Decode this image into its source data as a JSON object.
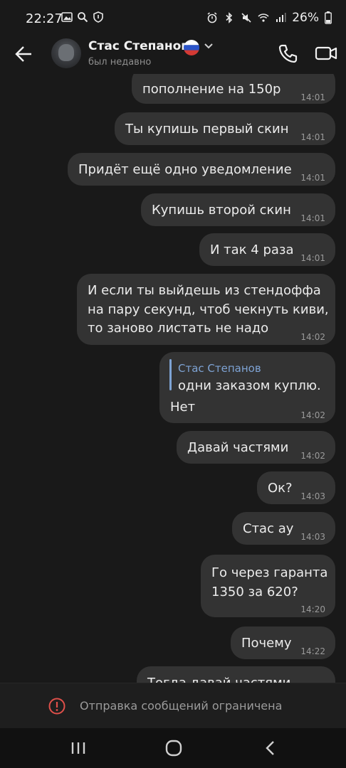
{
  "status_bar": {
    "time": "22:27",
    "battery": "26%"
  },
  "header": {
    "contact_name": "Стас Степанов",
    "status": "был недавно"
  },
  "messages": [
    {
      "text_lines": [
        "пополнение на 150р"
      ],
      "time": "14:01"
    },
    {
      "text_lines": [
        "Ты купишь первый скин"
      ],
      "time": "14:01"
    },
    {
      "text_lines": [
        "Придёт ещё одно уведомление"
      ],
      "time": "14:01"
    },
    {
      "text_lines": [
        "Купишь второй скин"
      ],
      "time": "14:01"
    },
    {
      "text_lines": [
        "И так 4 раза"
      ],
      "time": "14:01"
    },
    {
      "text_lines": [
        "И если ты выйдешь из стендоффа",
        "на пару секунд, чтоб чекнуть киви,",
        "то заново листать не надо"
      ],
      "time": "14:02"
    },
    {
      "reply_to": {
        "name": "Стас Степанов",
        "text": "одни заказом куплю."
      },
      "text_lines": [
        "Нет"
      ],
      "time": "14:02"
    },
    {
      "text_lines": [
        "Давай частями"
      ],
      "time": "14:02"
    },
    {
      "text_lines": [
        "Ок?"
      ],
      "time": "14:03"
    },
    {
      "text_lines": [
        "Стас ау"
      ],
      "time": "14:03"
    },
    {
      "text_lines": [
        "Го через гаранта",
        "1350 за 620?"
      ],
      "time": "14:20"
    },
    {
      "text_lines": [
        "Почему"
      ],
      "time": "14:22"
    },
    {
      "text_lines": [
        "Тогда давай частями"
      ],
      "time": ""
    }
  ],
  "restricted_notice": "Отправка сообщений ограничена",
  "icons": {
    "back": "arrow-left-icon",
    "call": "phone-icon",
    "video": "video-camera-icon",
    "warning": "warning-circle-icon",
    "nav_recent": "recent-apps-icon",
    "nav_home": "home-icon",
    "nav_back": "nav-back-icon"
  },
  "colors": {
    "bubble": "#333333",
    "background": "#191919",
    "reply_accent": "#7ea3d4",
    "warning": "#e0504a"
  }
}
